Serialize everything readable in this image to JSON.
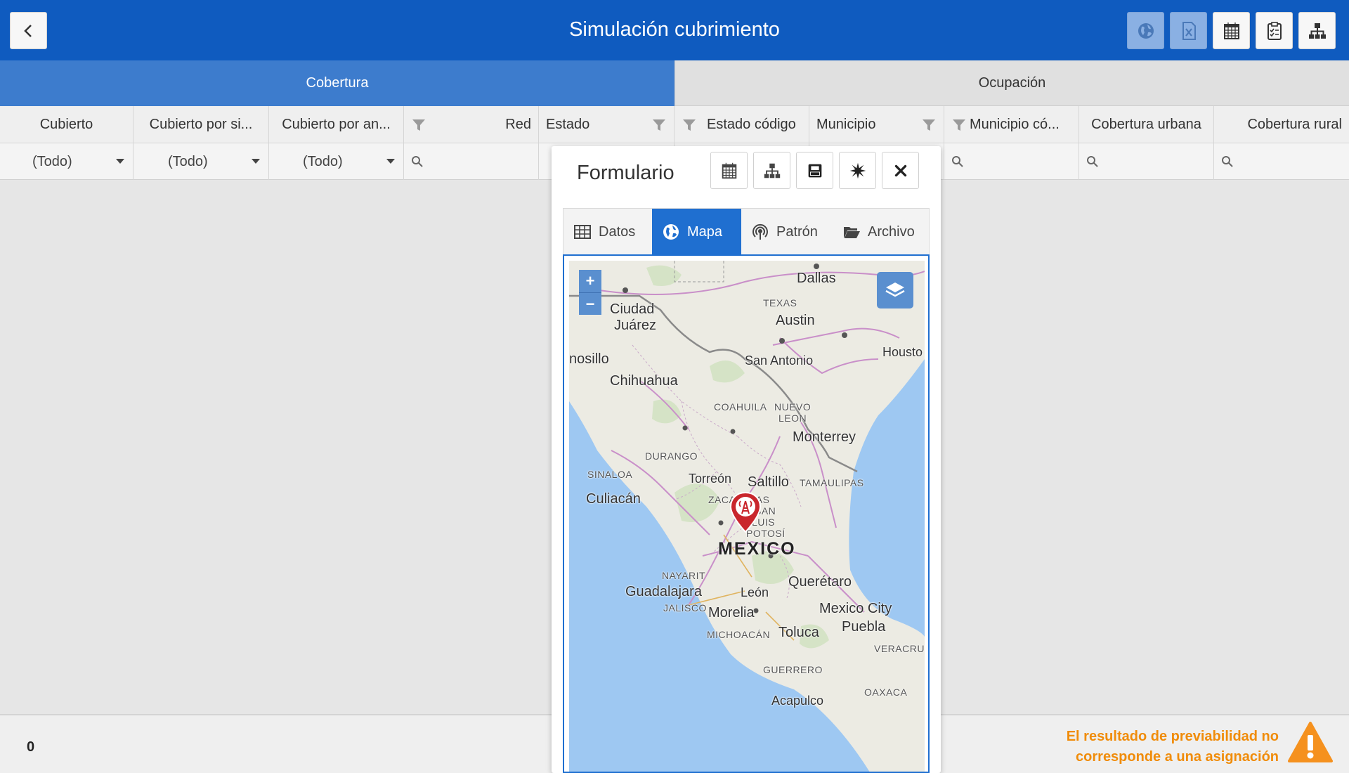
{
  "header": {
    "title": "Simulación cubrimiento",
    "back_icon": "chevron-left-icon",
    "buttons": [
      {
        "name": "globe-button",
        "icon": "globe-icon",
        "state": "disabled"
      },
      {
        "name": "excel-export-button",
        "icon": "excel-icon",
        "state": "disabled"
      },
      {
        "name": "calendar-button",
        "icon": "calendar-icon",
        "state": "enabled"
      },
      {
        "name": "clipboard-checklist-button",
        "icon": "clipboard-checklist-icon",
        "state": "enabled"
      },
      {
        "name": "hierarchy-button",
        "icon": "sitemap-icon",
        "state": "enabled"
      }
    ]
  },
  "tabs": [
    {
      "label": "Cobertura",
      "active": true
    },
    {
      "label": "Ocupación",
      "active": false
    }
  ],
  "grid": {
    "columns": [
      {
        "label": "Cubierto"
      },
      {
        "label": "Cubierto por si..."
      },
      {
        "label": "Cubierto por an..."
      },
      {
        "label": "Red"
      },
      {
        "label": "Estado"
      },
      {
        "label": "Estado código"
      },
      {
        "label": "Municipio"
      },
      {
        "label": "Municipio có..."
      },
      {
        "label": "Cobertura urbana"
      },
      {
        "label": "Cobertura rural"
      }
    ],
    "filters": {
      "select_value": "(Todo)"
    }
  },
  "footer": {
    "count": "0",
    "warning_line1": "El resultado de previabilidad no",
    "warning_line2": "corresponde a una asignación",
    "warning_color": "#f08c0a"
  },
  "modal": {
    "title": "Formulario",
    "buttons": [
      {
        "name": "calendar-button",
        "icon": "calendar-icon"
      },
      {
        "name": "hierarchy-button",
        "icon": "sitemap-icon"
      },
      {
        "name": "save-button",
        "icon": "save-icon"
      },
      {
        "name": "burst-button",
        "icon": "burst-icon"
      },
      {
        "name": "close-button",
        "icon": "close-icon"
      }
    ],
    "tabs": [
      {
        "label": "Datos",
        "icon": "table-icon",
        "active": false
      },
      {
        "label": "Mapa",
        "icon": "globe-icon",
        "active": true
      },
      {
        "label": "Patrón",
        "icon": "broadcast-icon",
        "active": false
      },
      {
        "label": "Archivo",
        "icon": "folder-open-icon",
        "active": false
      }
    ],
    "map": {
      "zoom_in": "+",
      "zoom_out": "−",
      "labels": {
        "dallas": "Dallas",
        "texas": "TEXAS",
        "austin": "Austin",
        "ciudad": "Ciudad",
        "juarez": "Juárez",
        "san_antonio": "San Antonio",
        "houston": "Housto",
        "hermosillo": "nosillo",
        "chihuahua": "Chihuahua",
        "coahuila": "COAHUILA",
        "nuevo": "NUEVO",
        "leon_state": "LEON",
        "durango": "DURANGO",
        "monterrey": "Monterrey",
        "sinaloa": "SINALOA",
        "torreon": "Torreón",
        "saltillo": "Saltillo",
        "tamaulipas": "TAMAULIPAS",
        "culiacan": "Culiacán",
        "zacatecas": "ZACATECAS",
        "san": "SAN",
        "luis": "LUIS",
        "potosi": "POTOSÍ",
        "mexico": "MEXICO",
        "nayarit": "NAYARIT",
        "queretaro": "Querétaro",
        "guadalajara": "Guadalajara",
        "leon": "León",
        "jalisco": "JALISCO",
        "morelia": "Morelia",
        "mexico_city": "Mexico City",
        "michoacan": "MICHOACÁN",
        "toluca": "Toluca",
        "puebla": "Puebla",
        "veracruz": "VERACRUZ",
        "guerrero": "GUERRERO",
        "oaxaca": "OAXACA",
        "acapulco": "Acapulco"
      },
      "marker_icon": "antenna-marker-icon"
    }
  }
}
